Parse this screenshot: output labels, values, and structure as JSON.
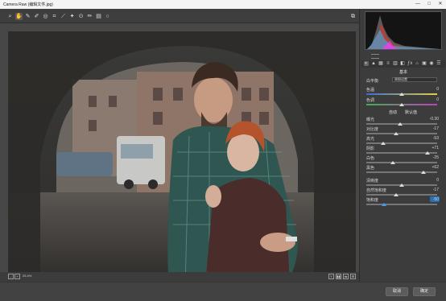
{
  "window": {
    "title": "Camera Raw (编辑文件.jpg)",
    "minimize": "—",
    "maximize": "□",
    "close": "✕"
  },
  "toolbar": {
    "tools": [
      {
        "name": "zoom-tool-icon",
        "glyph": "⌕"
      },
      {
        "name": "hand-tool-icon",
        "glyph": "✋",
        "active": true
      },
      {
        "name": "white-balance-tool-icon",
        "glyph": "✎"
      },
      {
        "name": "color-sampler-tool-icon",
        "glyph": "✐"
      },
      {
        "name": "targeted-adjustment-tool-icon",
        "glyph": "◎"
      },
      {
        "name": "crop-tool-icon",
        "glyph": "⌗"
      },
      {
        "name": "straighten-tool-icon",
        "glyph": "⟋"
      },
      {
        "name": "spot-removal-tool-icon",
        "glyph": "✦"
      },
      {
        "name": "red-eye-tool-icon",
        "glyph": "⊙"
      },
      {
        "name": "adjustment-brush-icon",
        "glyph": "✏"
      },
      {
        "name": "graduated-filter-icon",
        "glyph": "▤"
      },
      {
        "name": "radial-filter-icon",
        "glyph": "○"
      }
    ],
    "open_preferences_glyph": "⧉"
  },
  "histogram": {
    "colors": [
      "#ff3030",
      "#30c0ff",
      "#ffffff",
      "#30ff60",
      "#ff30ff"
    ]
  },
  "panel": {
    "tabs": [
      "◐",
      "▲",
      "▦",
      "≡",
      "▥",
      "◧",
      "ƒx",
      "⌂",
      "▣",
      "◉",
      "☰"
    ],
    "section_title": "基本",
    "profile_label": "白平衡",
    "profile_value": "原照设置",
    "temp_label": "色温",
    "temp_value": "0",
    "tint_label": "色调",
    "tint_value": "0",
    "auto_label": "自动",
    "default_label": "默认值",
    "sliders": [
      {
        "label": "曝光",
        "value": "-0.30",
        "pos": 0.48
      },
      {
        "label": "对比度",
        "value": "-17",
        "pos": 0.42
      },
      {
        "label": "高光",
        "value": "-53",
        "pos": 0.24
      },
      {
        "label": "阴影",
        "value": "+71",
        "pos": 0.86
      },
      {
        "label": "白色",
        "value": "-25",
        "pos": 0.38
      },
      {
        "label": "黑色",
        "value": "+62",
        "pos": 0.81
      }
    ],
    "presence": [
      {
        "label": "清晰度",
        "value": "0",
        "pos": 0.5
      },
      {
        "label": "自然饱和度",
        "value": "-17",
        "pos": 0.42
      },
      {
        "label": "饱和度",
        "value": "-50",
        "pos": 0.25,
        "active": true
      }
    ]
  },
  "bottombar": {
    "zoom_value": "25.4%",
    "view_buttons": [
      "Y",
      "▮▮",
      "⇆",
      "⚙"
    ]
  },
  "footer": {
    "cancel_label": "取消",
    "done_label": "确定"
  },
  "colors": {
    "accent": "#3aa0ff",
    "panel_bg": "#3c3c3c"
  }
}
